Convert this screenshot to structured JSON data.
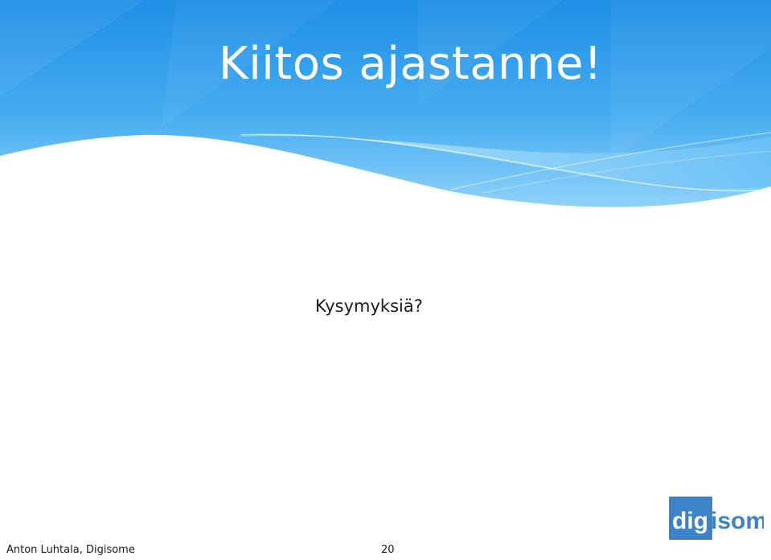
{
  "slide": {
    "title": "Kiitos ajastanne!",
    "subtitle": "Kysymyksiä?",
    "footer_author": "Anton Luhtala, Digisome",
    "page_number": "20",
    "logo_text": "digisome"
  },
  "theme": {
    "header_blue_dark": "#1f8fe6",
    "header_blue_light": "#9fd8fb",
    "logo_blue": "#3c84c7"
  }
}
